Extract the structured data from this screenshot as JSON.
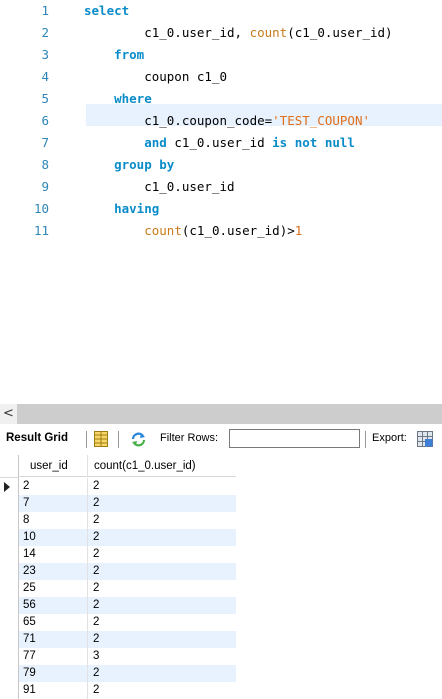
{
  "editor": {
    "lines": [
      {
        "n": "1",
        "parts": [
          {
            "t": "select",
            "k": "kw"
          }
        ]
      },
      {
        "n": "2",
        "parts": [
          {
            "t": "        c1_0.user_id, ",
            "k": ""
          },
          {
            "t": "count",
            "k": "fn"
          },
          {
            "t": "(c1_0.user_id)",
            "k": ""
          }
        ]
      },
      {
        "n": "3",
        "parts": [
          {
            "t": "    ",
            "k": ""
          },
          {
            "t": "from",
            "k": "kw"
          }
        ]
      },
      {
        "n": "4",
        "parts": [
          {
            "t": "        coupon c1_0",
            "k": ""
          }
        ]
      },
      {
        "n": "5",
        "parts": [
          {
            "t": "    ",
            "k": ""
          },
          {
            "t": "where",
            "k": "kw"
          }
        ]
      },
      {
        "n": "6",
        "parts": [
          {
            "t": "        c1_0.coupon_code=",
            "k": ""
          },
          {
            "t": "'TEST_COUPON'",
            "k": "str"
          }
        ]
      },
      {
        "n": "7",
        "parts": [
          {
            "t": "        ",
            "k": ""
          },
          {
            "t": "and",
            "k": "kw"
          },
          {
            "t": " c1_0.user_id ",
            "k": ""
          },
          {
            "t": "is not null",
            "k": "kw"
          }
        ]
      },
      {
        "n": "8",
        "parts": [
          {
            "t": "    ",
            "k": ""
          },
          {
            "t": "group by",
            "k": "kw"
          }
        ]
      },
      {
        "n": "9",
        "parts": [
          {
            "t": "        c1_0.user_id",
            "k": ""
          }
        ]
      },
      {
        "n": "10",
        "parts": [
          {
            "t": "    ",
            "k": ""
          },
          {
            "t": "having",
            "k": "kw"
          }
        ]
      },
      {
        "n": "11",
        "parts": [
          {
            "t": "        ",
            "k": ""
          },
          {
            "t": "count",
            "k": "fn"
          },
          {
            "t": "(c1_0.user_id)>",
            "k": ""
          },
          {
            "t": "1",
            "k": "num"
          }
        ]
      }
    ]
  },
  "scrollbar": {
    "left_arrow": "<"
  },
  "toolbar": {
    "result_grid_label": "Result Grid",
    "filter_rows_label": "Filter Rows:",
    "filter_value": "",
    "export_label": "Export:"
  },
  "grid": {
    "columns": [
      "user_id",
      "count(c1_0.user_id)"
    ],
    "rows": [
      [
        "2",
        "2"
      ],
      [
        "7",
        "2"
      ],
      [
        "8",
        "2"
      ],
      [
        "10",
        "2"
      ],
      [
        "14",
        "2"
      ],
      [
        "23",
        "2"
      ],
      [
        "25",
        "2"
      ],
      [
        "56",
        "2"
      ],
      [
        "65",
        "2"
      ],
      [
        "71",
        "2"
      ],
      [
        "77",
        "3"
      ],
      [
        "79",
        "2"
      ],
      [
        "91",
        "2"
      ]
    ]
  }
}
